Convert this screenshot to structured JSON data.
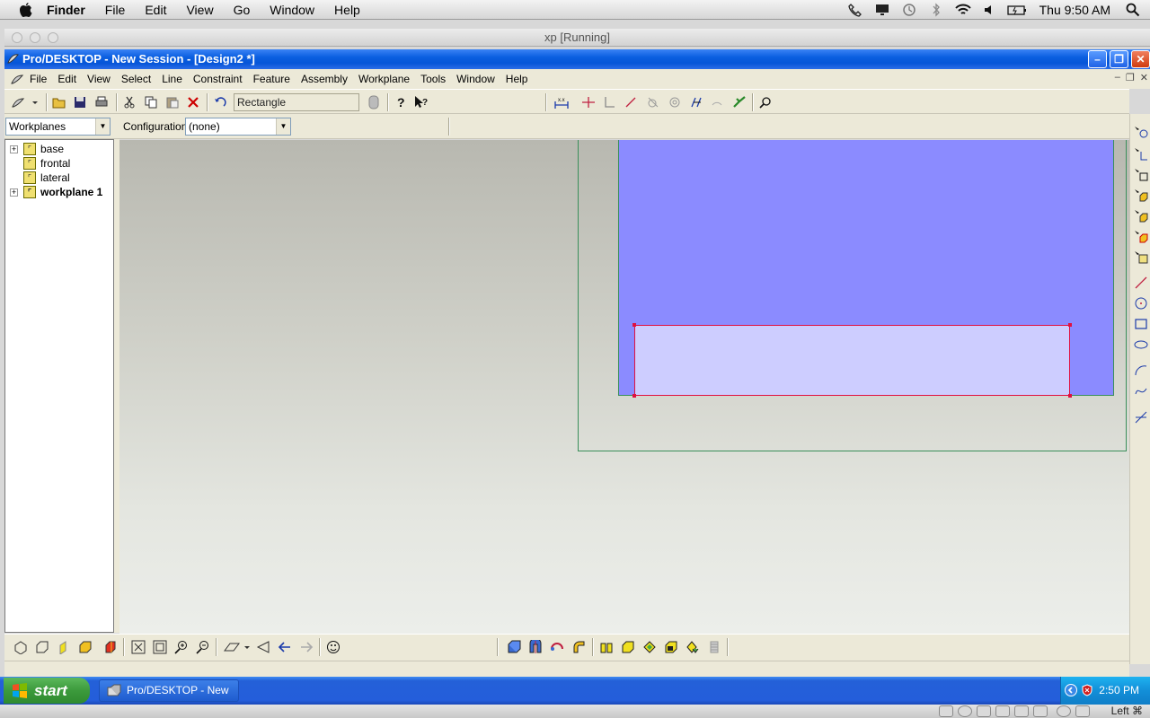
{
  "mac_menubar": {
    "app_name": "Finder",
    "menus": [
      "File",
      "Edit",
      "View",
      "Go",
      "Window",
      "Help"
    ],
    "clock": "Thu 9:50 AM"
  },
  "vm_window": {
    "title": "xp [Running]"
  },
  "app_window": {
    "title": "Pro/DESKTOP - New Session - [Design2 *]",
    "menus": [
      "File",
      "Edit",
      "View",
      "Select",
      "Line",
      "Constraint",
      "Feature",
      "Assembly",
      "Workplane",
      "Tools",
      "Window",
      "Help"
    ]
  },
  "toolbar": {
    "command_field": "Rectangle"
  },
  "browser": {
    "view_select": "Workplanes",
    "configuration_label": "Configuration:",
    "configuration_value": "(none)",
    "tree": [
      {
        "label": "base",
        "expandable": true,
        "bold": false
      },
      {
        "label": "frontal",
        "expandable": false,
        "bold": false
      },
      {
        "label": "lateral",
        "expandable": false,
        "bold": false
      },
      {
        "label": "workplane 1",
        "expandable": true,
        "bold": true
      }
    ]
  },
  "taskbar": {
    "start_label": "start",
    "task_button": "Pro/DESKTOP - New ...",
    "clock": "2:50 PM"
  },
  "vm_status": {
    "hotkey": "Left ⌘"
  },
  "colors": {
    "sketch_outline": "#e01040",
    "workplane_fill": "#8b8bff",
    "rectangle_fill": "#cdcdff",
    "workplane_border": "#3a8f5a",
    "xp_titlebar": "#0a5fe0"
  }
}
